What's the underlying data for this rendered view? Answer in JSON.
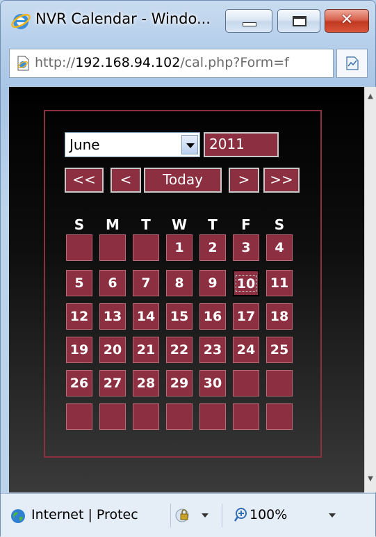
{
  "window": {
    "title": "NVR Calendar - Windo...",
    "close_label": "✕"
  },
  "address": {
    "url_prefix": "http://",
    "url_host": "192.168.94.102",
    "url_rest": "/cal.php?Form=f"
  },
  "calendar": {
    "month": "June",
    "year": "2011",
    "nav": {
      "prev_year": "<<",
      "prev_month": "<",
      "today": "Today",
      "next_month": ">",
      "next_year": ">>"
    },
    "weekdays": [
      "S",
      "M",
      "T",
      "W",
      "T",
      "F",
      "S"
    ],
    "weeks": [
      [
        "",
        "",
        "",
        "1",
        "2",
        "3",
        "4"
      ],
      [
        "5",
        "6",
        "7",
        "8",
        "9",
        "10",
        "11"
      ],
      [
        "12",
        "13",
        "14",
        "15",
        "16",
        "17",
        "18"
      ],
      [
        "19",
        "20",
        "21",
        "22",
        "23",
        "24",
        "25"
      ],
      [
        "26",
        "27",
        "28",
        "29",
        "30",
        "",
        ""
      ],
      [
        "",
        "",
        "",
        "",
        "",
        "",
        ""
      ]
    ],
    "selected_day": "10",
    "accent_color": "#8c2f40"
  },
  "status": {
    "zone": "Internet | Protec",
    "zoom": "100%"
  },
  "icons": {
    "browser": "ie-logo-icon",
    "page": "page-icon",
    "compat": "compatibility-view-icon",
    "zone": "globe-icon",
    "protect": "protected-mode-icon",
    "zoom": "zoom-icon"
  }
}
